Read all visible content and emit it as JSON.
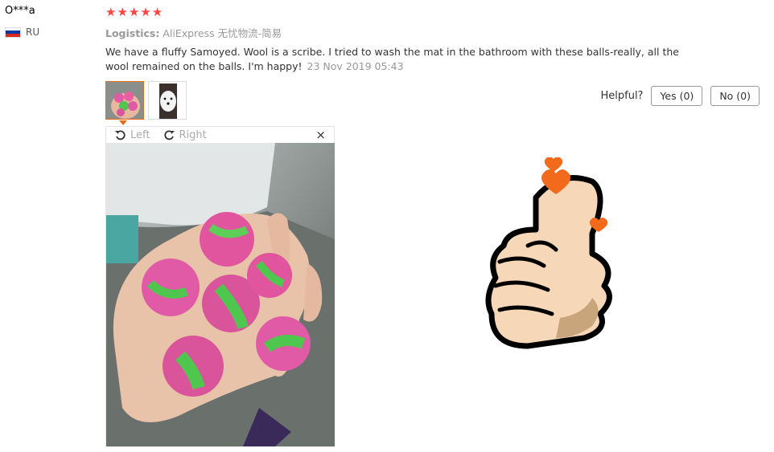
{
  "reviewer": {
    "name": "O***a",
    "country": "RU"
  },
  "rating": {
    "stars": 5,
    "max": 5
  },
  "logistics": {
    "label": "Logistics:",
    "value": "AliExpress 无忧物流-简易"
  },
  "review": {
    "text": "We have a fluffy Samoyed. Wool is a scribe. I tried to wash the mat in the bathroom with these balls-really, all the wool remained on the balls. I'm happy!",
    "date": "23 Nov 2019 05:43"
  },
  "helpful": {
    "label": "Helpful?",
    "yes": "Yes (0)",
    "no": "No (0)"
  },
  "viewer": {
    "left_label": "Left",
    "right_label": "Right",
    "close": "×"
  },
  "colors": {
    "star": "#ff4444",
    "accent": "#e86b1c",
    "heart": "#f26b1d"
  }
}
